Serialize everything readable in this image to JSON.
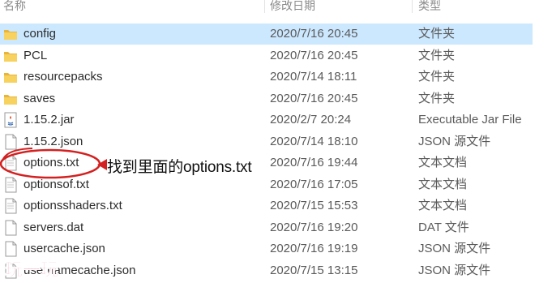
{
  "columns": {
    "name": "名称",
    "date": "修改日期",
    "type": "类型"
  },
  "files": [
    {
      "name": "config",
      "date": "2020/7/16 20:45",
      "type": "文件夹",
      "icon": "folder-icon",
      "selected": true
    },
    {
      "name": "PCL",
      "date": "2020/7/16 20:45",
      "type": "文件夹",
      "icon": "folder-icon"
    },
    {
      "name": "resourcepacks",
      "date": "2020/7/14 18:11",
      "type": "文件夹",
      "icon": "folder-icon"
    },
    {
      "name": "saves",
      "date": "2020/7/16 20:45",
      "type": "文件夹",
      "icon": "folder-icon"
    },
    {
      "name": "1.15.2.jar",
      "date": "2020/2/7 20:24",
      "type": "Executable Jar File",
      "icon": "java-jar-icon"
    },
    {
      "name": "1.15.2.json",
      "date": "2020/7/14 18:10",
      "type": "JSON 源文件",
      "icon": "document-icon"
    },
    {
      "name": "options.txt",
      "date": "2020/7/16 19:44",
      "type": "文本文档",
      "icon": "text-file-icon"
    },
    {
      "name": "optionsof.txt",
      "date": "2020/7/16 17:05",
      "type": "文本文档",
      "icon": "text-file-icon"
    },
    {
      "name": "optionsshaders.txt",
      "date": "2020/7/15 15:53",
      "type": "文本文档",
      "icon": "text-file-icon"
    },
    {
      "name": "servers.dat",
      "date": "2020/7/16 19:20",
      "type": "DAT 文件",
      "icon": "document-icon"
    },
    {
      "name": "usercache.json",
      "date": "2020/7/16 19:19",
      "type": "JSON 源文件",
      "icon": "document-icon"
    },
    {
      "name": "usernamecache.json",
      "date": "2020/7/15 13:15",
      "type": "JSON 源文件",
      "icon": "document-icon"
    }
  ],
  "annotation": {
    "text": "找到里面的options.txt",
    "color": "#d32020"
  },
  "watermark": {
    "text": "玩一玩"
  },
  "colors": {
    "selection": "#cce8ff",
    "folder": "#f3c64a",
    "annotation": "#d32020"
  }
}
